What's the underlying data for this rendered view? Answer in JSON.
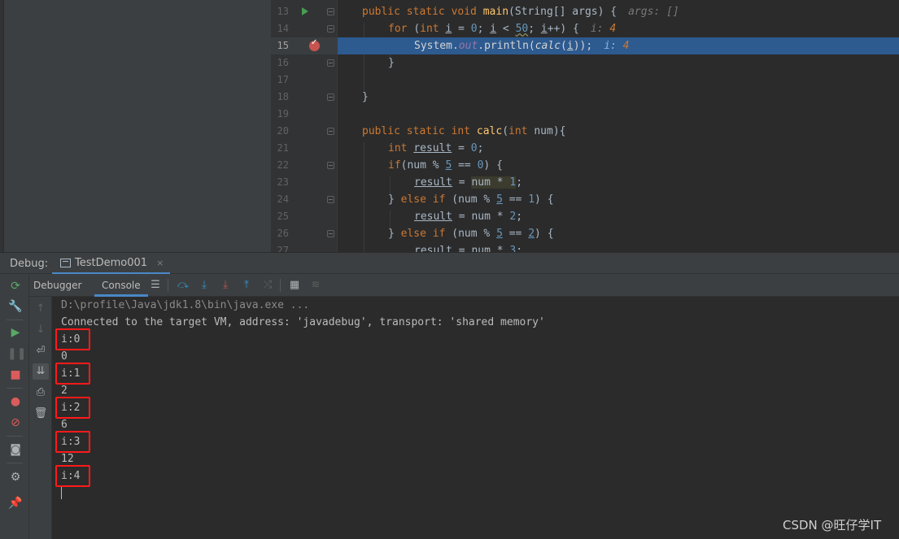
{
  "editor": {
    "lines": [
      {
        "n": "13",
        "text": "public static void main(String[] args) {",
        "hint_label": "args:",
        "hint_value": "[]"
      },
      {
        "n": "14",
        "text": "for (int i = 0; i < 50; i++) {",
        "hint_label": "i:",
        "hint_value": "4"
      },
      {
        "n": "15",
        "text": "System.out.println(calc(i));",
        "hint_label": "i:",
        "hint_value": "4"
      },
      {
        "n": "16",
        "text": "}"
      },
      {
        "n": "17",
        "text": ""
      },
      {
        "n": "18",
        "text": "}"
      },
      {
        "n": "19",
        "text": ""
      },
      {
        "n": "20",
        "text": "public static int calc(int num){"
      },
      {
        "n": "21",
        "text": "int result = 0;"
      },
      {
        "n": "22",
        "text": "if(num % 5 == 0) {"
      },
      {
        "n": "23",
        "text": "result = num * 1;"
      },
      {
        "n": "24",
        "text": "} else if (num % 5 == 1) {"
      },
      {
        "n": "25",
        "text": "result = num * 2;"
      },
      {
        "n": "26",
        "text": "} else if (num % 5 == 2) {"
      },
      {
        "n": "27",
        "text": "result = num * 3;"
      }
    ],
    "current_line": "15",
    "colors": {
      "current_line_bg": "#2d5a8f",
      "breakpoint": "#c75450",
      "keyword": "#cc7832",
      "method": "#ffc66d",
      "number": "#6897bb"
    }
  },
  "debug": {
    "label": "Debug:",
    "session_tab": "TestDemo001",
    "session_close": "×",
    "subtabs": {
      "debugger": "Debugger",
      "console": "Console"
    }
  },
  "console": {
    "command": "D:\\profile\\Java\\jdk1.8\\bin\\java.exe ...",
    "connected": "Connected to the target VM, address: 'javadebug', transport: 'shared memory'",
    "output": [
      {
        "label": "i:0",
        "value": "0"
      },
      {
        "label": "i:1",
        "value": "2"
      },
      {
        "label": "i:2",
        "value": "6"
      },
      {
        "label": "i:3",
        "value": "12"
      },
      {
        "label": "i:4",
        "value": ""
      }
    ],
    "highlight_color": "#ff1a1a"
  },
  "icons": {
    "left_toolbar": [
      "rerun-icon",
      "settings-wrench-icon",
      "resume-icon",
      "pause-icon",
      "stop-icon",
      "view-breakpoints-icon",
      "mute-breakpoints-icon",
      "snapshot-icon",
      "settings-gear-icon",
      "pin-icon"
    ],
    "sub_toolbar": [
      "layout-icon",
      "step-over-icon",
      "step-into-icon",
      "force-step-into-icon",
      "step-out-icon",
      "run-to-cursor-icon",
      "evaluate-icon",
      "trace-icon"
    ],
    "console_toolbar": [
      "up-arrow-icon",
      "down-arrow-icon",
      "soft-wrap-icon",
      "scroll-to-end-icon",
      "print-icon",
      "clear-icon"
    ]
  },
  "watermark": "CSDN @旺仔学IT"
}
